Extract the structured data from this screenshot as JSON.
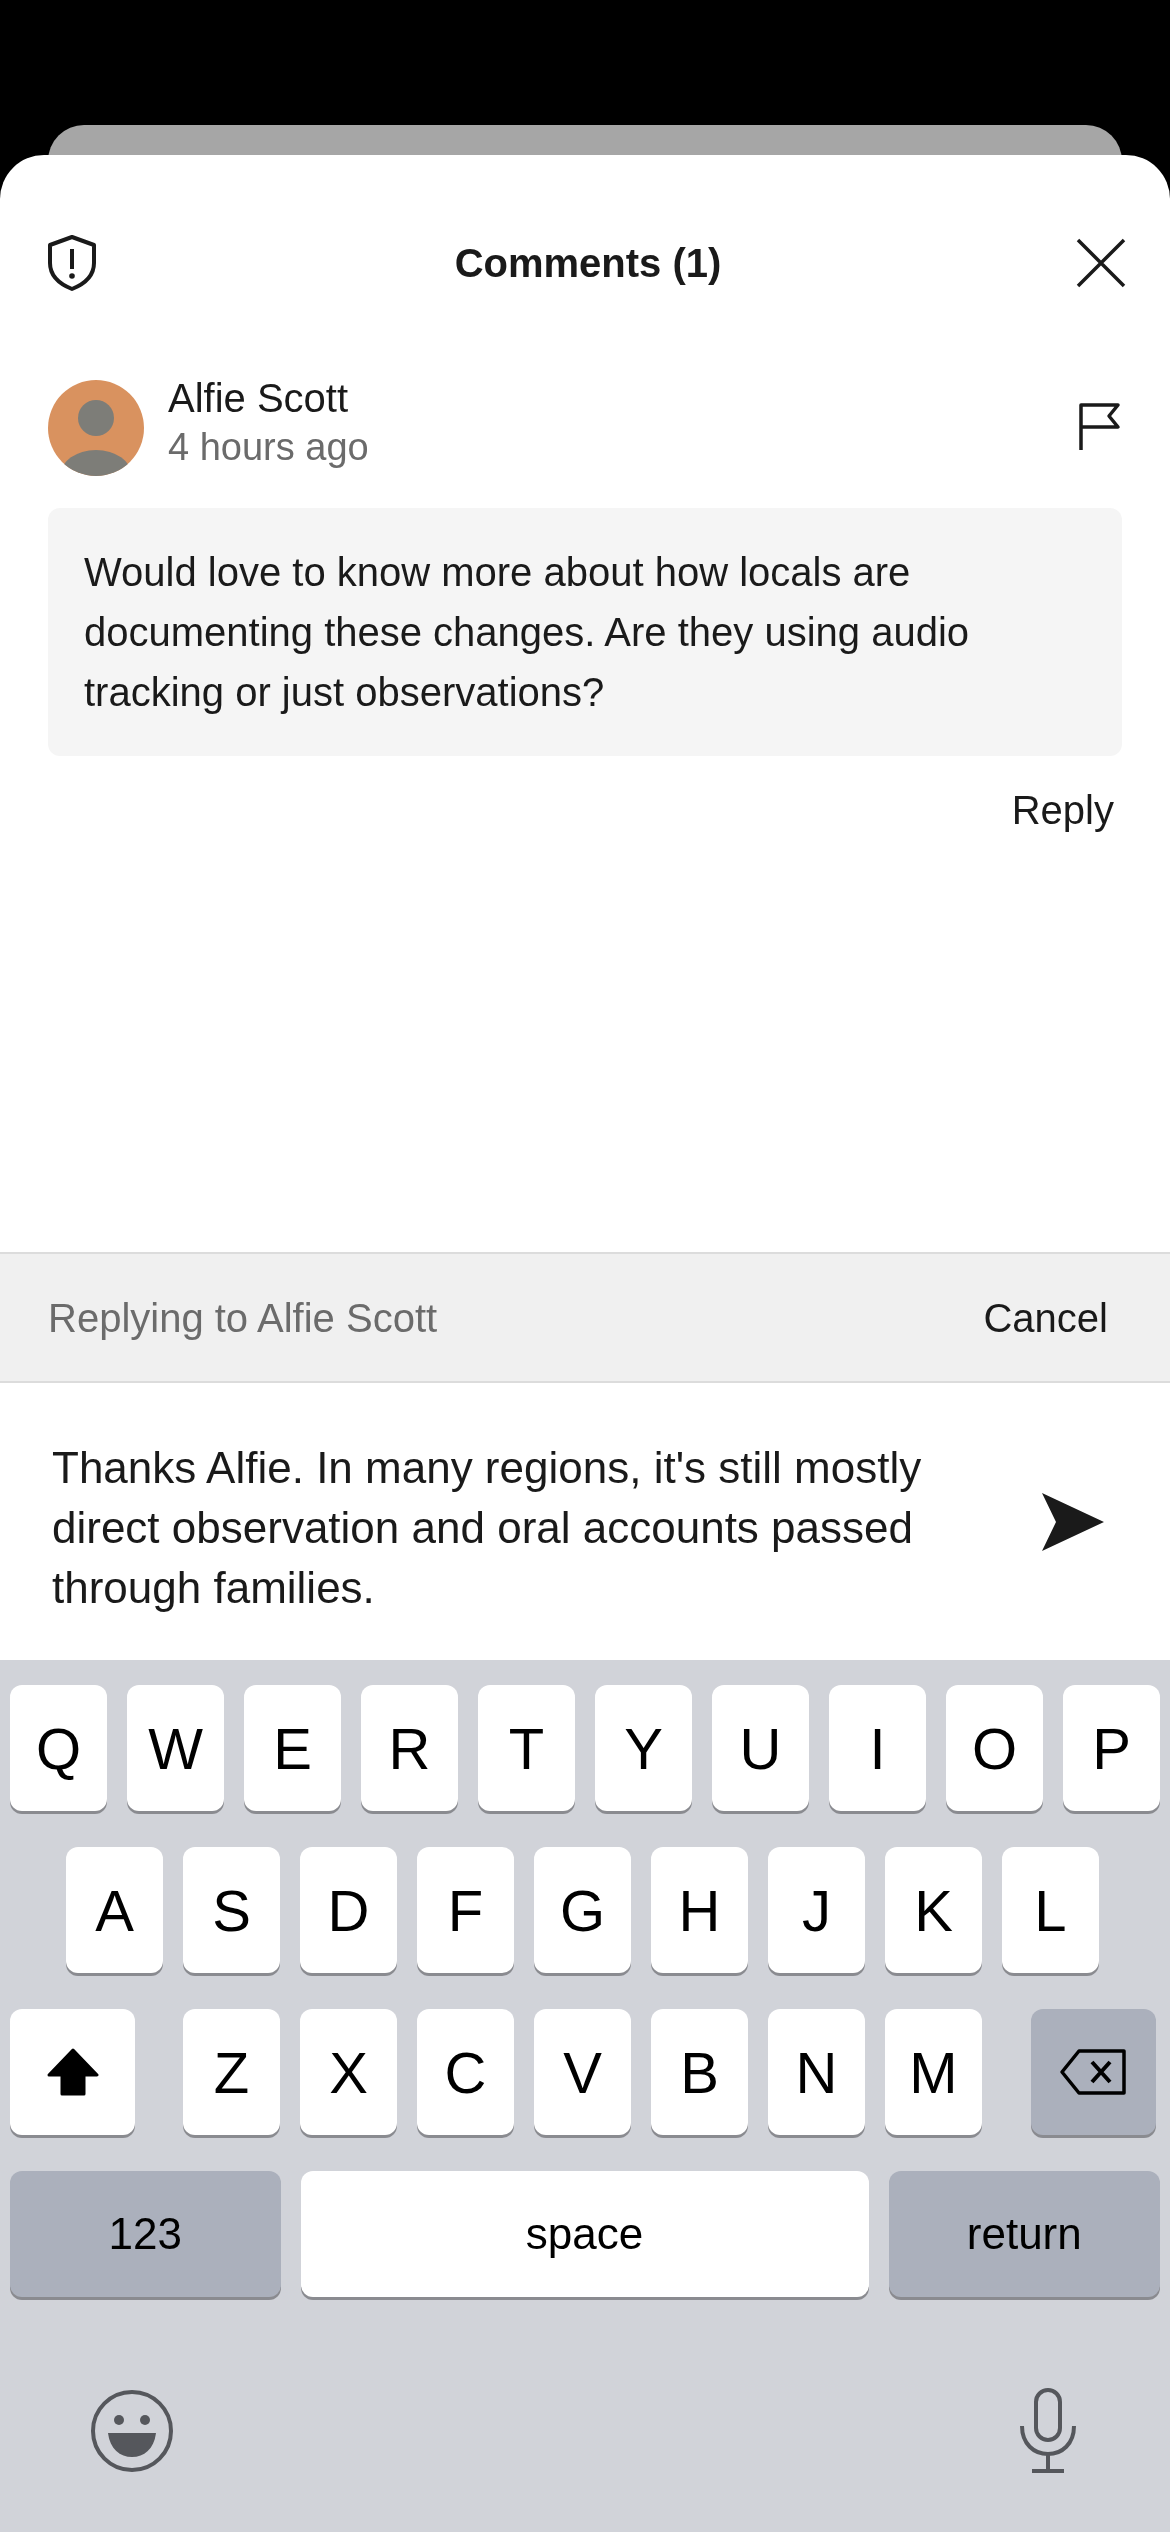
{
  "sheet": {
    "title": "Comments (1)"
  },
  "comments": [
    {
      "author": "Alfie Scott",
      "time": "4 hours ago",
      "text": "Would love to know more about how locals are documenting these changes. Are they using audio tracking or just observations?",
      "action": "Reply"
    }
  ],
  "reply_bar": {
    "label": "Replying to Alfie Scott",
    "cancel": "Cancel"
  },
  "composer": {
    "value": "Thanks Alfie. In many regions, it's still mostly direct observation and oral accounts passed through families."
  },
  "keyboard": {
    "shift_on": true,
    "rows": [
      [
        {
          "kind": "letter",
          "label": "Q"
        },
        {
          "kind": "letter",
          "label": "W"
        },
        {
          "kind": "letter",
          "label": "E"
        },
        {
          "kind": "letter",
          "label": "R"
        },
        {
          "kind": "letter",
          "label": "T"
        },
        {
          "kind": "letter",
          "label": "Y"
        },
        {
          "kind": "letter",
          "label": "U"
        },
        {
          "kind": "letter",
          "label": "I"
        },
        {
          "kind": "letter",
          "label": "O"
        },
        {
          "kind": "letter",
          "label": "P"
        }
      ],
      [
        {
          "kind": "letter",
          "label": "A"
        },
        {
          "kind": "letter",
          "label": "S"
        },
        {
          "kind": "letter",
          "label": "D"
        },
        {
          "kind": "letter",
          "label": "F"
        },
        {
          "kind": "letter",
          "label": "G"
        },
        {
          "kind": "letter",
          "label": "H"
        },
        {
          "kind": "letter",
          "label": "J"
        },
        {
          "kind": "letter",
          "label": "K"
        },
        {
          "kind": "letter",
          "label": "L"
        }
      ],
      [
        {
          "kind": "shift"
        },
        {
          "kind": "letter",
          "label": "Z"
        },
        {
          "kind": "letter",
          "label": "X"
        },
        {
          "kind": "letter",
          "label": "C"
        },
        {
          "kind": "letter",
          "label": "V"
        },
        {
          "kind": "letter",
          "label": "B"
        },
        {
          "kind": "letter",
          "label": "N"
        },
        {
          "kind": "letter",
          "label": "M"
        },
        {
          "kind": "backspace"
        }
      ]
    ],
    "bottom_row": [
      {
        "kind": "mode",
        "label": "123"
      },
      {
        "kind": "space",
        "label": "space"
      },
      {
        "kind": "return",
        "label": "return"
      }
    ]
  }
}
